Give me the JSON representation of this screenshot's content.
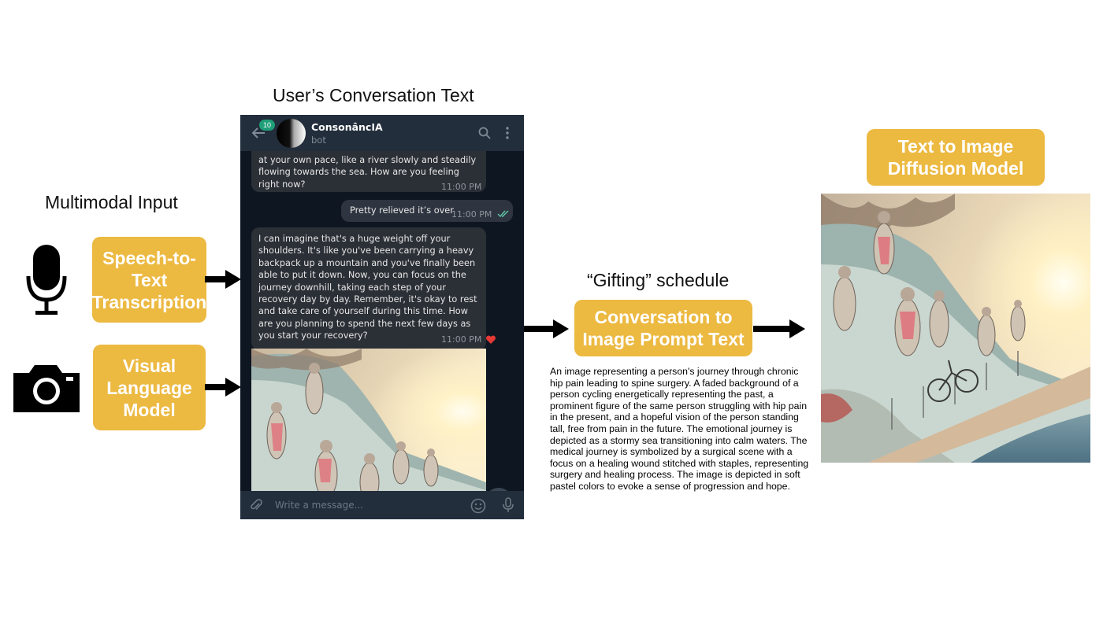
{
  "headings": {
    "conversation": "User’s Conversation Text",
    "multimodal": "Multimodal Input",
    "gifting": "“Gifting” schedule"
  },
  "boxes": {
    "speech": "Speech-to-Text Transcription",
    "visual": "Visual Language Model",
    "prompt": "Conversation to Image Prompt Text",
    "diffusion": "Text to Image Diffusion Model"
  },
  "phone": {
    "badge": "10",
    "bot_name": "ConsonâncIA",
    "bot_status": "bot",
    "messages": [
      {
        "text": "at your own pace, like a river slowly and steadily flowing towards the sea. How are you feeling right now?",
        "time": "11:00 PM"
      },
      {
        "text": "Pretty relieved it’s over",
        "time": "11:00 PM"
      },
      {
        "text": "I can imagine that's a huge weight off your shoulders. It's like you've been carrying a heavy backpack up a mountain and you've finally been able to put it down. Now, you can focus on the journey downhill, taking each step of your recovery day by day. Remember, it's okay to rest and take care of yourself during this time. How are you planning to spend the next few days as you start your recovery?",
        "time": "11:00 PM"
      }
    ],
    "input_placeholder": "Write a message..."
  },
  "prompt_text": "An image representing a person's journey through chronic hip pain leading to spine surgery. A faded background of a person cycling energetically representing the past, a prominent figure of the same person struggling with hip pain in the present, and a hopeful vision of the person standing tall, free from pain in the future. The emotional journey is depicted as a stormy sea transitioning into calm waters. The medical journey is symbolized by a surgical scene with a focus on a healing wound stitched with staples, representing surgery and healing process. The image is depicted in soft pastel colors to evoke a sense of progression and hope.",
  "icons": [
    "microphone-icon",
    "camera-icon",
    "back-arrow-icon",
    "search-icon",
    "more-icon",
    "double-check-icon",
    "heart-icon",
    "scroll-down-icon",
    "attach-icon",
    "emoji-icon",
    "voice-icon"
  ],
  "colors": {
    "box": "#ECB941",
    "phone_bg": "#17212B",
    "header": "#232E3C",
    "bubble": "#2B2F36",
    "badge": "#1E9F78"
  }
}
